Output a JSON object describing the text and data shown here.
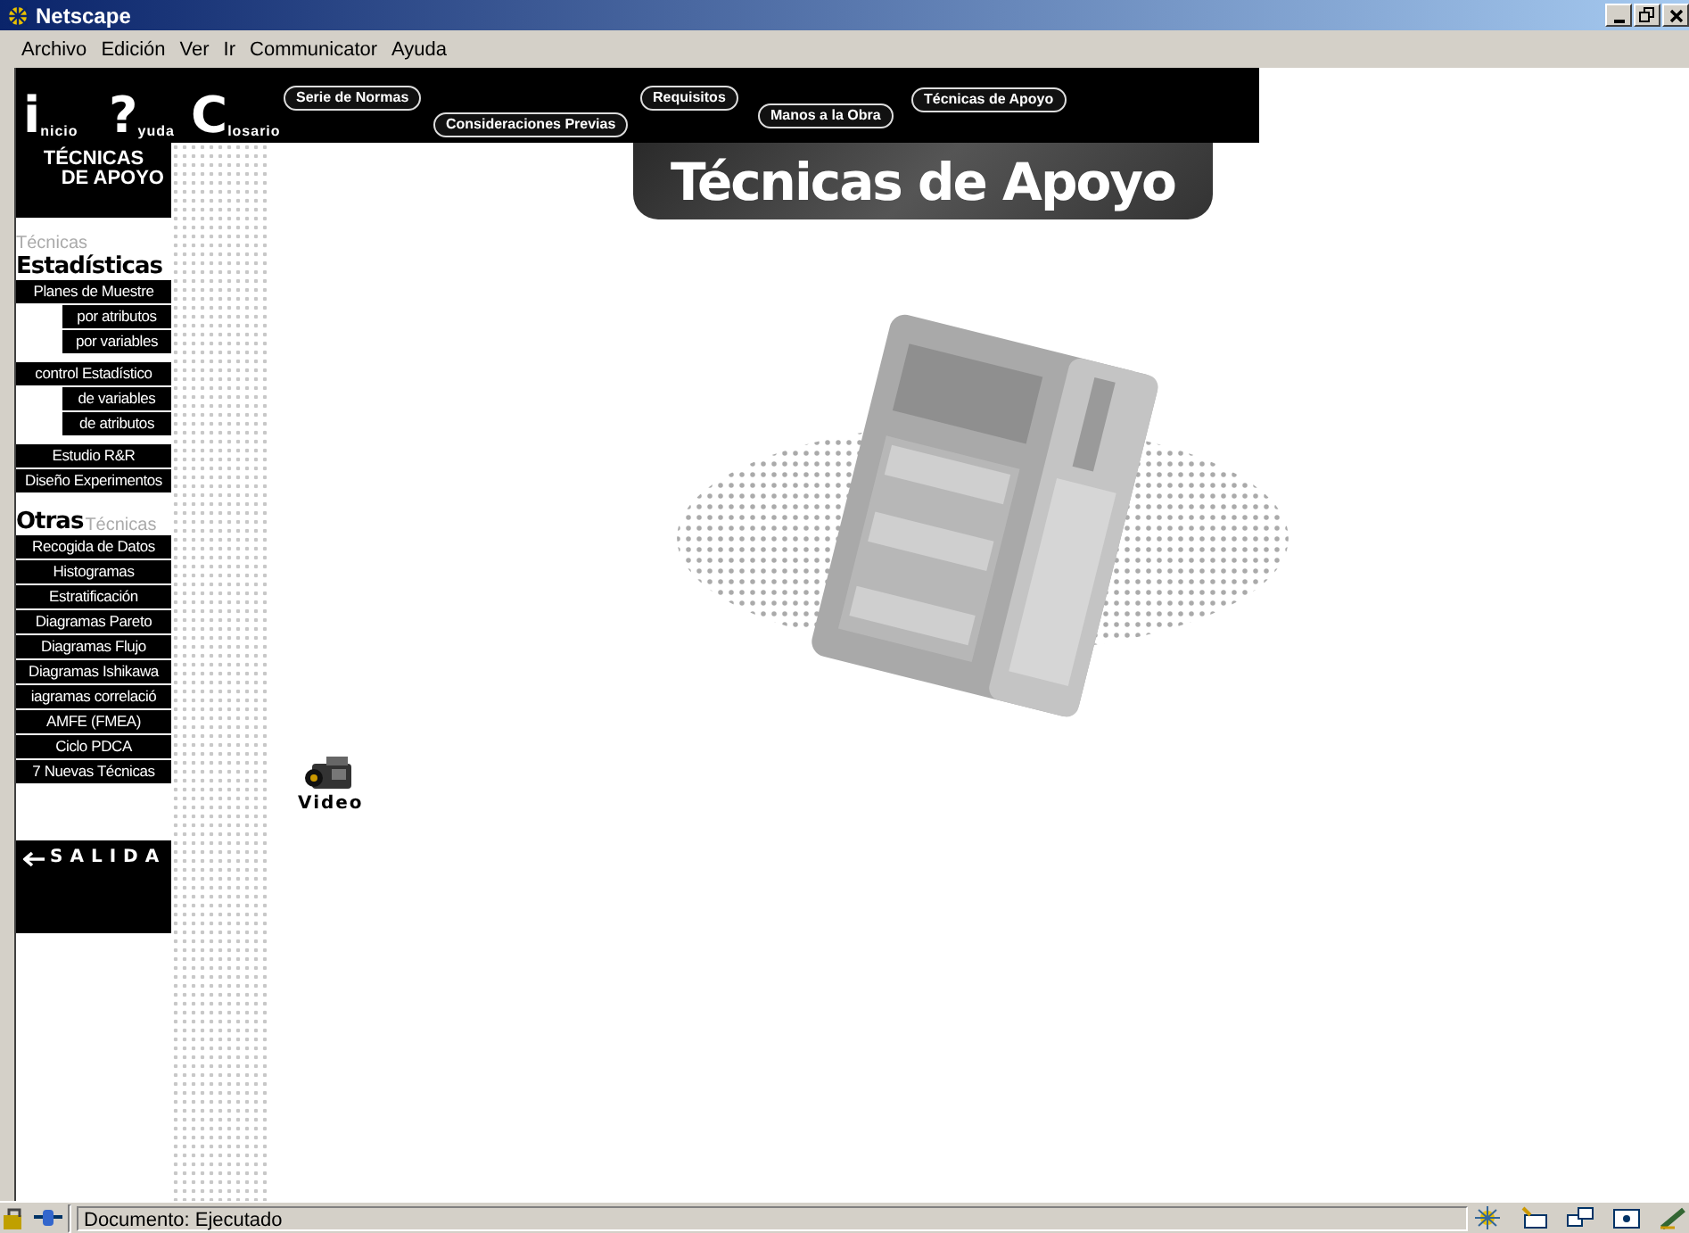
{
  "window": {
    "title": "Netscape"
  },
  "menu": [
    "Archivo",
    "Edición",
    "Ver",
    "Ir",
    "Communicator",
    "Ayuda"
  ],
  "toolbar_links": [
    {
      "initial": "i",
      "rest": "nicio"
    },
    {
      "initial": "?",
      "rest": "yuda"
    },
    {
      "initial": "C",
      "rest": "losario"
    }
  ],
  "section_links": [
    {
      "label": "Serie de Normas"
    },
    {
      "label": "Consideraciones Previas"
    },
    {
      "label": "Requisitos"
    },
    {
      "label": "Manos a la Obra"
    },
    {
      "label": "Técnicas de Apoyo"
    }
  ],
  "sidebar": {
    "title_lines": [
      "TÉCNICAS",
      "DE APOYO"
    ],
    "groups": [
      {
        "small_title": "Técnicas",
        "title": "Estadísticas",
        "items": [
          {
            "label": "Planes de Muestre",
            "kind": "main"
          },
          {
            "label": "por atributos",
            "kind": "sub"
          },
          {
            "label": "por variables",
            "kind": "sub"
          },
          {
            "label": "control Estadístico",
            "kind": "main"
          },
          {
            "label": "de variables",
            "kind": "sub"
          },
          {
            "label": "de atributos",
            "kind": "sub"
          },
          {
            "label": "Estudio R&R",
            "kind": "main"
          },
          {
            "label": "Diseño Experimentos",
            "kind": "main"
          }
        ]
      },
      {
        "small_title": "Técnicas",
        "title": "Otras",
        "items": [
          {
            "label": "Recogida de Datos",
            "kind": "main"
          },
          {
            "label": "Histogramas",
            "kind": "main"
          },
          {
            "label": "Estratificación",
            "kind": "main"
          },
          {
            "label": "Diagramas Pareto",
            "kind": "main"
          },
          {
            "label": "Diagramas Flujo",
            "kind": "main"
          },
          {
            "label": "Diagramas Ishikawa",
            "kind": "main"
          },
          {
            "label": "iagramas correlació",
            "kind": "main"
          },
          {
            "label": "AMFE (FMEA)",
            "kind": "main"
          },
          {
            "label": "Ciclo PDCA",
            "kind": "main"
          },
          {
            "label": "7 Nuevas Técnicas",
            "kind": "main"
          }
        ]
      }
    ],
    "exit_button": "SALIDA"
  },
  "page_title": "Técnicas de Apoyo",
  "video_link": "Video",
  "status_bar": {
    "text": "Documento: Ejecutado"
  }
}
